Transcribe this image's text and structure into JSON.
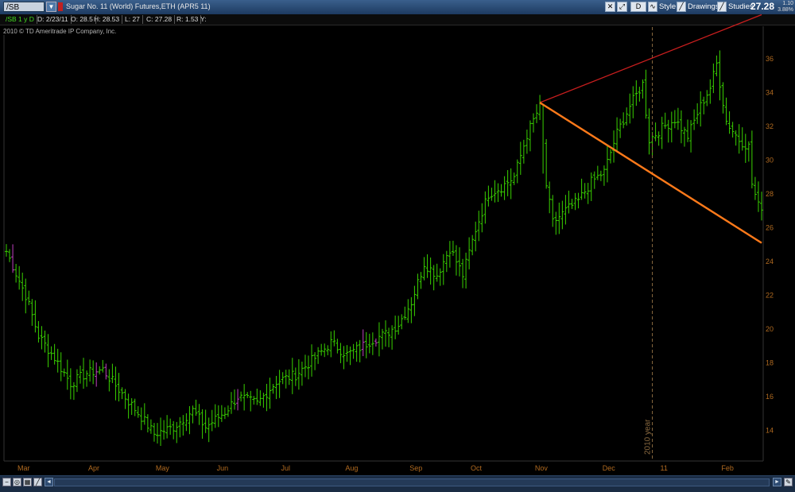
{
  "header": {
    "symbol": "/SB",
    "description": "Sugar No. 11 (World)  Futures,ETH (APR5 11)",
    "interval_button": "D",
    "style_label": "Style",
    "drawings_label": "Drawings",
    "studies_label": "Studies",
    "last_price": "27.28",
    "change": "1.10",
    "change_pct": "3.88%"
  },
  "infobar": {
    "chart_id": "/SB 1 y D",
    "date": "D: 2/23/11",
    "open": "O: 28.5",
    "high": "H: 28.53",
    "low": "L: 27",
    "close": "C: 27.28",
    "range": "R: 1.53",
    "y": "Y:"
  },
  "copyright": "2010 © TD Ameritrade IP Company, Inc.",
  "colors": {
    "bar_up": "#39d100",
    "bar_alt": "#c040c0",
    "axis_text": "#b06a20",
    "trend_upper": "#c81e1e",
    "trend_lower": "#ff7a1a",
    "year_marker": "#8a6a40"
  },
  "chart_data": {
    "type": "bar",
    "title": "Sugar No. 11 (World)  Futures,ETH (APR5 11)",
    "ylim": [
      12.2,
      37.4
    ],
    "yticks": [
      14,
      16,
      18,
      20,
      22,
      24,
      26,
      28,
      30,
      32,
      34,
      36
    ],
    "xticks": [
      {
        "label": "Mar",
        "x": 1
      },
      {
        "label": "Apr",
        "x": 23
      },
      {
        "label": "May",
        "x": 44
      },
      {
        "label": "Jun",
        "x": 63
      },
      {
        "label": "Jul",
        "x": 83
      },
      {
        "label": "Aug",
        "x": 103
      },
      {
        "label": "Sep",
        "x": 123
      },
      {
        "label": "Oct",
        "x": 142
      },
      {
        "label": "Nov",
        "x": 162
      },
      {
        "label": "Dec",
        "x": 183
      },
      {
        "label": "11",
        "x": 201
      },
      {
        "label": "Feb",
        "x": 220
      }
    ],
    "xlim": [
      0,
      235
    ],
    "year_marker": {
      "label": "2010 year",
      "x": 201
    },
    "anchors": [
      [
        0,
        24.6
      ],
      [
        6,
        22.0
      ],
      [
        10,
        19.6
      ],
      [
        15,
        18.3
      ],
      [
        20,
        16.8
      ],
      [
        25,
        17.4
      ],
      [
        30,
        17.6
      ],
      [
        36,
        16.2
      ],
      [
        42,
        14.8
      ],
      [
        46,
        13.8
      ],
      [
        52,
        14.2
      ],
      [
        58,
        15.2
      ],
      [
        62,
        14.2
      ],
      [
        68,
        15.1
      ],
      [
        72,
        16.0
      ],
      [
        78,
        15.6
      ],
      [
        84,
        16.9
      ],
      [
        90,
        17.3
      ],
      [
        96,
        18.3
      ],
      [
        101,
        19.2
      ],
      [
        106,
        18.5
      ],
      [
        110,
        18.9
      ],
      [
        114,
        19.4
      ],
      [
        118,
        19.7
      ],
      [
        122,
        20.3
      ],
      [
        126,
        21.6
      ],
      [
        130,
        23.9
      ],
      [
        134,
        23.2
      ],
      [
        138,
        24.8
      ],
      [
        142,
        23.2
      ],
      [
        146,
        25.9
      ],
      [
        150,
        28.0
      ],
      [
        154,
        28.4
      ],
      [
        158,
        29.0
      ],
      [
        162,
        31.5
      ],
      [
        166,
        33.2
      ],
      [
        168,
        28.5
      ],
      [
        170,
        26.3
      ],
      [
        174,
        27.0
      ],
      [
        178,
        27.6
      ],
      [
        182,
        28.7
      ],
      [
        186,
        29.3
      ],
      [
        190,
        31.6
      ],
      [
        194,
        33.2
      ],
      [
        198,
        34.5
      ],
      [
        200,
        31.2
      ],
      [
        204,
        31.9
      ],
      [
        208,
        32.4
      ],
      [
        212,
        31.4
      ],
      [
        216,
        33.2
      ],
      [
        219,
        34.3
      ],
      [
        221,
        35.7
      ],
      [
        224,
        32.3
      ],
      [
        228,
        31.2
      ],
      [
        231,
        30.8
      ],
      [
        232,
        28.6
      ],
      [
        234,
        27.28
      ]
    ],
    "highlight_bars": [
      2,
      28,
      31,
      72,
      111,
      115
    ],
    "trendlines": [
      {
        "from": [
          166,
          33.4
        ],
        "to": [
          235,
          38.6
        ],
        "color": "trend_upper"
      },
      {
        "from": [
          166,
          33.4
        ],
        "to": [
          235,
          25.1
        ],
        "color": "trend_lower"
      }
    ]
  },
  "bottombar": {
    "zoom_label": "◄"
  }
}
